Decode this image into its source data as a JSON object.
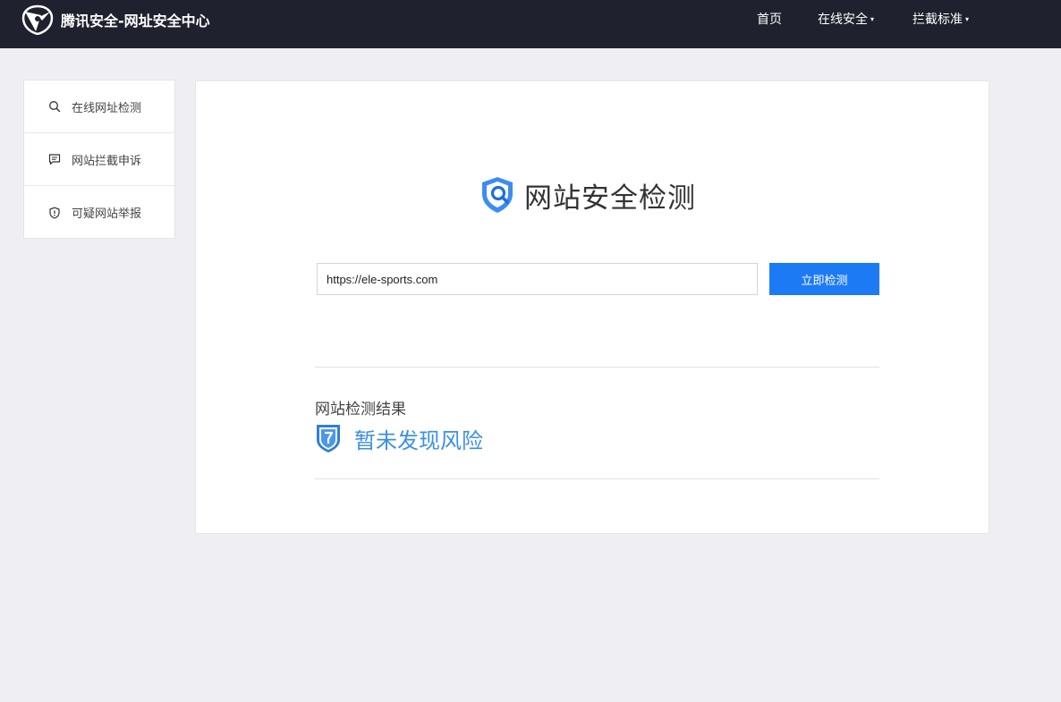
{
  "header": {
    "site_title": "腾讯安全-网址安全中心",
    "nav": {
      "home": "首页",
      "online_security": "在线安全",
      "block_standard": "拦截标准",
      "caret": "▾"
    }
  },
  "sidebar": {
    "items": [
      {
        "label": "在线网址检测",
        "icon": "search-icon"
      },
      {
        "label": "网站拦截申诉",
        "icon": "message-icon"
      },
      {
        "label": "可疑网站举报",
        "icon": "shield-alert-icon"
      }
    ]
  },
  "main": {
    "title": "网站安全检测",
    "url_value": "https://ele-sports.com",
    "check_button": "立即检测",
    "result_label": "网站检测结果",
    "result_value": "暂未发现风险"
  },
  "colors": {
    "topbar": "#1f222e",
    "accent_blue": "#1d7af5",
    "result_blue": "#3c8fe6",
    "background": "#efeff3"
  }
}
